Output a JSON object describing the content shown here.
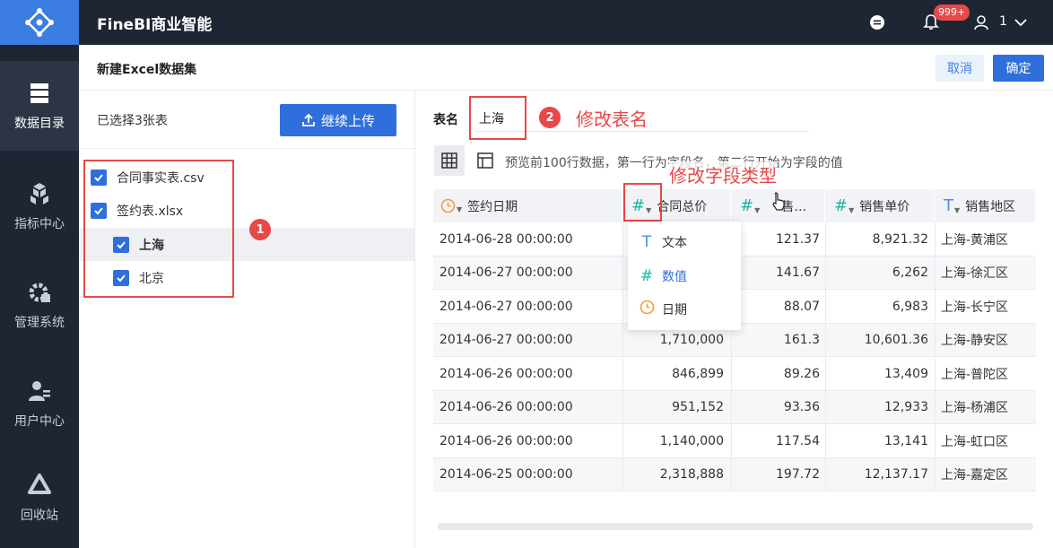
{
  "app": {
    "title": "FineBI商业智能",
    "notification_badge": "999+",
    "user_number": "1"
  },
  "rail": {
    "items": [
      {
        "label": "数据目录",
        "icon": "database-icon",
        "active": true
      },
      {
        "label": "指标中心",
        "icon": "cubes-icon",
        "active": false
      },
      {
        "label": "管理系统",
        "icon": "gear-icon",
        "active": false
      },
      {
        "label": "用户中心",
        "icon": "user-icon",
        "active": false
      },
      {
        "label": "回收站",
        "icon": "recycle-icon",
        "active": false
      }
    ]
  },
  "subheader": {
    "title": "新建Excel数据集",
    "cancel_label": "取消",
    "ok_label": "确定"
  },
  "left_panel": {
    "selected_count": "已选择3张表",
    "upload_label": "继续上传",
    "files": [
      {
        "label": "合同事实表.csv",
        "checked": true
      },
      {
        "label": "签约表.xlsx",
        "checked": true
      },
      {
        "label": "上海",
        "checked": true,
        "selected": true
      },
      {
        "label": "北京",
        "checked": true
      }
    ]
  },
  "annotations": {
    "step1": "1",
    "step2": "2",
    "rename_table": "修改表名",
    "change_field_type": "修改字段类型"
  },
  "right_panel": {
    "name_label": "表名",
    "name_value": "上海",
    "preview_hint": "预览前100行数据，第一行为字段名，第二行开始为字段的值"
  },
  "table": {
    "columns": [
      {
        "label": "签约日期",
        "type": "date-icon"
      },
      {
        "label": "合同总价",
        "type": "number-icon"
      },
      {
        "label": "售…",
        "type": "number-icon"
      },
      {
        "label": "销售单价",
        "type": "number-icon"
      },
      {
        "label": "销售地区",
        "type": "text-icon"
      }
    ],
    "rows": [
      [
        "2014-06-28 00:00:00",
        "",
        "121.37",
        "8,921.32",
        "上海-黄浦区"
      ],
      [
        "2014-06-27 00:00:00",
        "",
        "141.67",
        "6,262",
        "上海-徐汇区"
      ],
      [
        "2014-06-27 00:00:00",
        "",
        "88.07",
        "6,983",
        "上海-长宁区"
      ],
      [
        "2014-06-27 00:00:00",
        "1,710,000",
        "161.3",
        "10,601.36",
        "上海-静安区"
      ],
      [
        "2014-06-26 00:00:00",
        "846,899",
        "89.26",
        "13,409",
        "上海-普陀区"
      ],
      [
        "2014-06-26 00:00:00",
        "951,152",
        "93.36",
        "12,933",
        "上海-杨浦区"
      ],
      [
        "2014-06-26 00:00:00",
        "1,140,000",
        "117.54",
        "13,141",
        "上海-虹口区"
      ],
      [
        "2014-06-25 00:00:00",
        "2,318,888",
        "197.72",
        "12,137.17",
        "上海-嘉定区"
      ]
    ]
  },
  "type_dropdown": {
    "items": [
      {
        "label": "文本",
        "icon": "text-icon",
        "active": false
      },
      {
        "label": "数值",
        "icon": "number-icon",
        "active": true
      },
      {
        "label": "日期",
        "icon": "date-icon",
        "active": false
      }
    ]
  },
  "colors": {
    "accent": "#2f6fdb",
    "annotation": "#e84848",
    "rail_bg": "#1e2533",
    "number_type": "#1fb5a0",
    "date_type": "#f0a030",
    "text_type": "#4a8ee8"
  }
}
